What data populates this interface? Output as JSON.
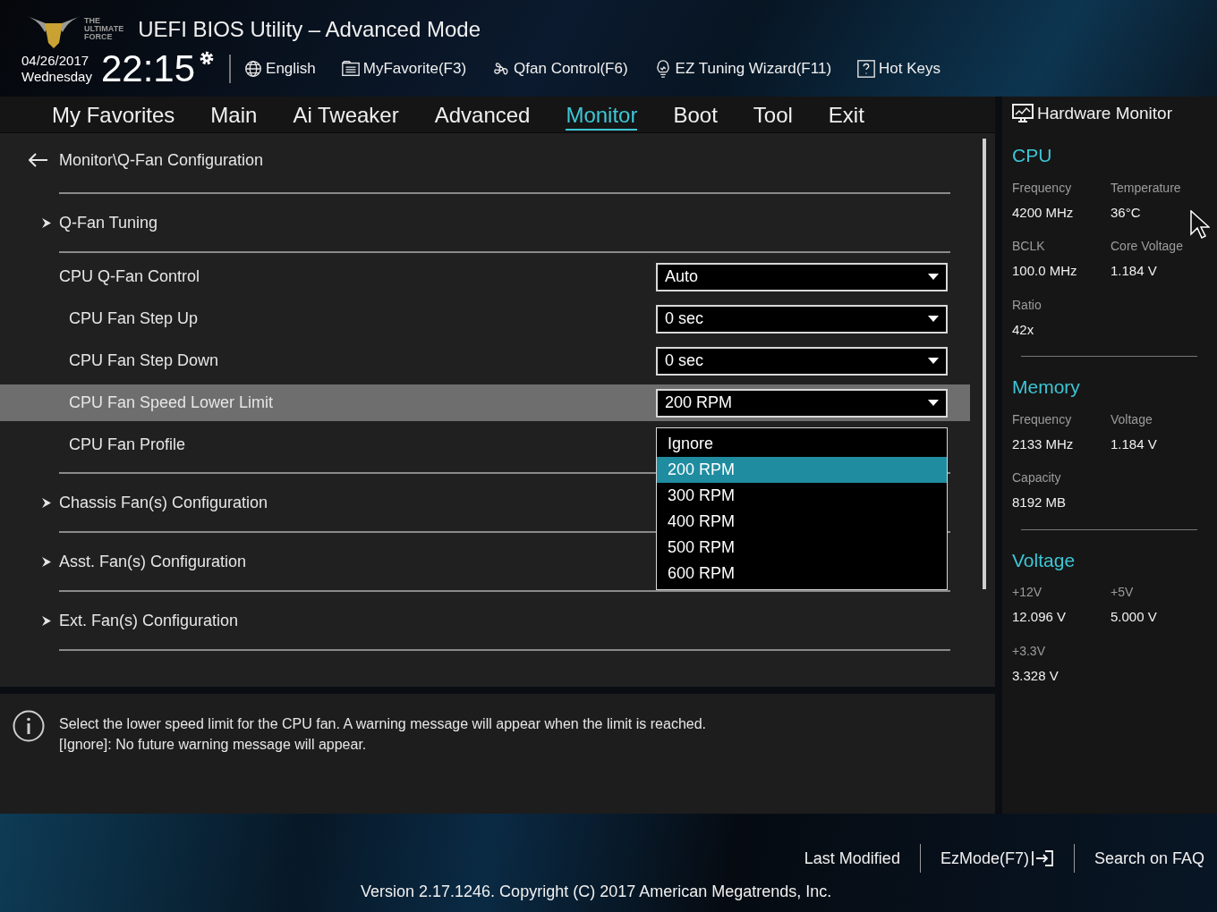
{
  "header": {
    "logo_text": [
      "THE",
      "ULTIMATE",
      "FORCE"
    ],
    "title": "UEFI BIOS Utility – Advanced Mode",
    "date": "04/26/2017",
    "day": "Wednesday",
    "time": "22:15",
    "tools": [
      {
        "kind": "language",
        "label": "English"
      },
      {
        "kind": "favorite",
        "label": "MyFavorite(F3)"
      },
      {
        "kind": "fan",
        "label": "Qfan Control(F6)"
      },
      {
        "kind": "wizard",
        "label": "EZ Tuning Wizard(F11)"
      },
      {
        "kind": "help",
        "label": "Hot Keys"
      }
    ]
  },
  "tabs": [
    {
      "label": "My Favorites",
      "selected": false
    },
    {
      "label": "Main",
      "selected": false
    },
    {
      "label": "Ai Tweaker",
      "selected": false
    },
    {
      "label": "Advanced",
      "selected": false
    },
    {
      "label": "Monitor",
      "selected": true
    },
    {
      "label": "Boot",
      "selected": false
    },
    {
      "label": "Tool",
      "selected": false
    },
    {
      "label": "Exit",
      "selected": false
    }
  ],
  "breadcrumb": "Monitor\\Q-Fan Configuration",
  "rows": [
    {
      "kind": "submenu",
      "label": "Q-Fan Tuning"
    },
    {
      "kind": "setting",
      "label": "CPU Q-Fan Control",
      "value": "Auto",
      "selected": false,
      "children": [
        {
          "kind": "setting",
          "label": "CPU Fan Step Up",
          "value": "0 sec",
          "selected": false
        },
        {
          "kind": "setting",
          "label": "CPU Fan Step Down",
          "value": "0 sec",
          "selected": false
        },
        {
          "kind": "setting",
          "label": "CPU Fan Speed Lower Limit",
          "value": "200 RPM",
          "selected": true,
          "options": [
            {
              "label": "Ignore",
              "selected": false
            },
            {
              "label": "200 RPM",
              "selected": true
            },
            {
              "label": "300 RPM",
              "selected": false
            },
            {
              "label": "400 RPM",
              "selected": false
            },
            {
              "label": "500 RPM",
              "selected": false
            },
            {
              "label": "600 RPM",
              "selected": false
            }
          ]
        },
        {
          "kind": "setting",
          "label": "CPU Fan Profile",
          "selected": false
        }
      ]
    },
    {
      "kind": "submenu",
      "label": "Chassis Fan(s) Configuration"
    },
    {
      "kind": "submenu",
      "label": "Asst. Fan(s) Configuration"
    },
    {
      "kind": "submenu",
      "label": "Ext. Fan(s) Configuration"
    }
  ],
  "help": [
    "Select the lower speed limit for the CPU fan. A warning message will appear when the limit is reached.",
    "[Ignore]: No future warning message will appear."
  ],
  "hardware_monitor": {
    "title": "Hardware Monitor",
    "sections": [
      {
        "title": "CPU",
        "items": [
          {
            "label": "Frequency",
            "value": "4200 MHz"
          },
          {
            "label": "Temperature",
            "value": "36°C"
          },
          {
            "label": "BCLK",
            "value": "100.0 MHz"
          },
          {
            "label": "Core Voltage",
            "value": "1.184 V"
          },
          {
            "label": "Ratio",
            "value": "42x"
          }
        ]
      },
      {
        "title": "Memory",
        "items": [
          {
            "label": "Frequency",
            "value": "2133 MHz"
          },
          {
            "label": "Voltage",
            "value": "1.184 V"
          },
          {
            "label": "Capacity",
            "value": "8192 MB"
          }
        ]
      },
      {
        "title": "Voltage",
        "items": [
          {
            "label": "+12V",
            "value": "12.096 V"
          },
          {
            "label": "+5V",
            "value": "5.000 V"
          },
          {
            "label": "+3.3V",
            "value": "3.328 V"
          }
        ]
      }
    ]
  },
  "footer": {
    "buttons": [
      {
        "kind": "text",
        "label": "Last Modified"
      },
      {
        "kind": "exit",
        "label": "EzMode(F7)"
      },
      {
        "kind": "text",
        "label": "Search on FAQ"
      }
    ],
    "version": "Version 2.17.1246. Copyright (C) 2017 American Megatrends, Inc."
  }
}
